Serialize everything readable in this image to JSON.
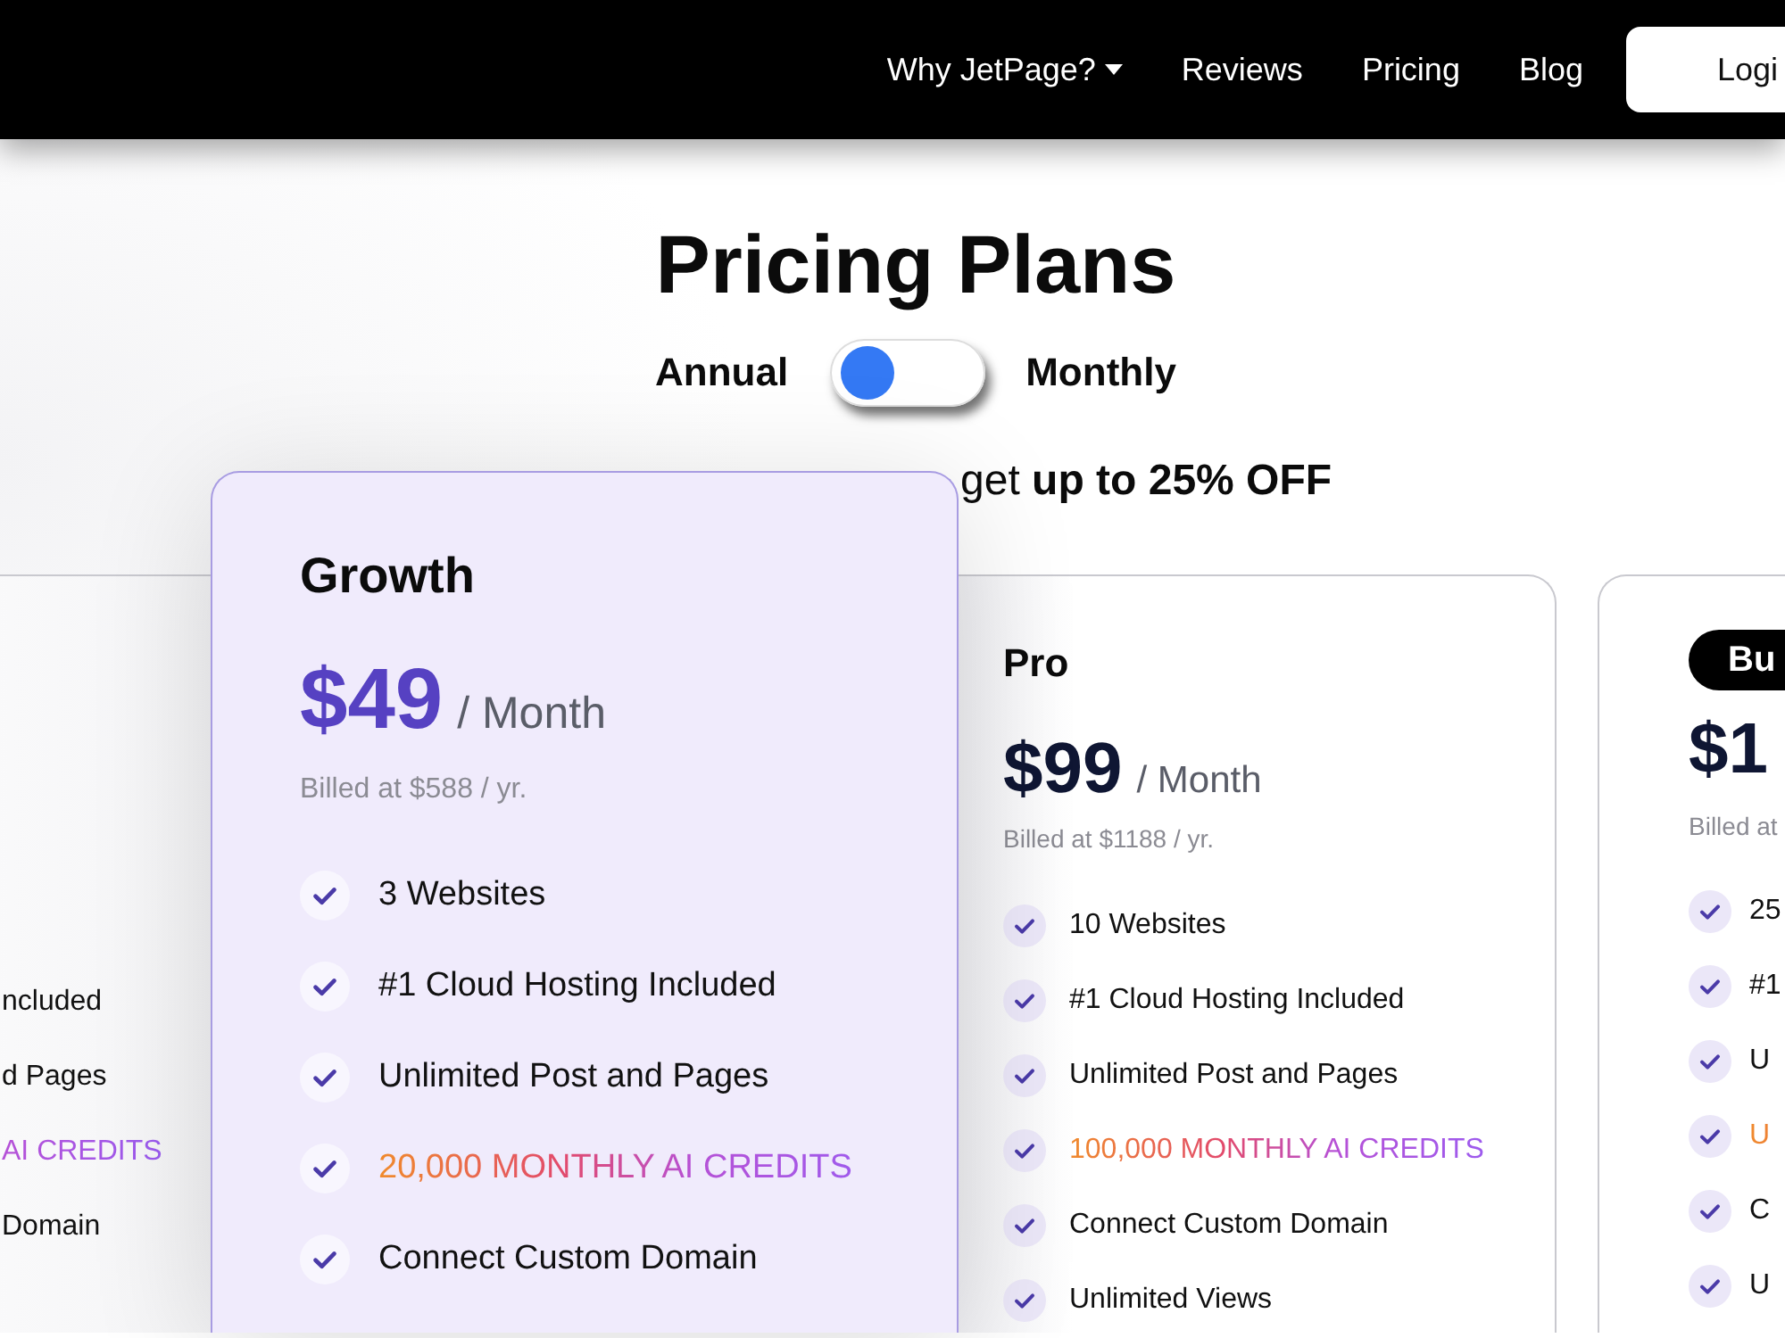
{
  "nav": {
    "links": [
      {
        "label": "Why JetPage?",
        "dropdown": true
      },
      {
        "label": "Reviews",
        "dropdown": false
      },
      {
        "label": "Pricing",
        "dropdown": false
      },
      {
        "label": "Blog",
        "dropdown": false
      }
    ],
    "login_button": "Logi"
  },
  "header": {
    "title": "Pricing Plans",
    "billing_toggle": {
      "left_label": "Annual",
      "right_label": "Monthly",
      "on": false
    },
    "subtitle": "get **up to 25% OFF**"
  },
  "plans": [
    {
      "kind": "clipped-left",
      "features": [
        {
          "text": "ncluded",
          "kind": "feature"
        },
        {
          "text": "d Pages",
          "kind": "feature"
        },
        {
          "text": "AI CREDITS",
          "kind": "credits"
        },
        {
          "text": "Domain",
          "kind": "feature"
        }
      ]
    },
    {
      "kind": "featured",
      "name": "Growth",
      "badge": false,
      "price": "$49",
      "period": "/ Month",
      "billed": "Billed at $588 / yr.",
      "features": [
        {
          "text": "3 Websites",
          "kind": "feature"
        },
        {
          "text": "#1 Cloud Hosting Included",
          "kind": "feature"
        },
        {
          "text": "Unlimited Post and Pages",
          "kind": "feature"
        },
        {
          "text": "20,000 MONTHLY AI CREDITS",
          "kind": "credits"
        },
        {
          "text": "Connect Custom Domain",
          "kind": "feature"
        }
      ]
    },
    {
      "kind": "plain",
      "name": "Pro",
      "badge": false,
      "price": "$99",
      "period": "/ Month",
      "billed": "Billed at $1188 / yr.",
      "features": [
        {
          "text": "10 Websites",
          "kind": "feature"
        },
        {
          "text": "#1 Cloud Hosting Included",
          "kind": "feature"
        },
        {
          "text": "Unlimited Post and Pages",
          "kind": "feature"
        },
        {
          "text": "100,000 MONTHLY AI CREDITS",
          "kind": "credits"
        },
        {
          "text": "Connect Custom Domain",
          "kind": "feature"
        },
        {
          "text": "Unlimited Views",
          "kind": "feature"
        }
      ]
    },
    {
      "kind": "clipped-right",
      "name": "Bu",
      "badge": true,
      "price": "$1",
      "billed": "Billed at",
      "features": [
        {
          "text": "25",
          "kind": "feature"
        },
        {
          "text": "#1",
          "kind": "feature"
        },
        {
          "text": "U",
          "kind": "feature"
        },
        {
          "text": "U",
          "kind": "credits"
        },
        {
          "text": "C",
          "kind": "feature"
        },
        {
          "text": "U",
          "kind": "feature"
        }
      ]
    }
  ]
}
